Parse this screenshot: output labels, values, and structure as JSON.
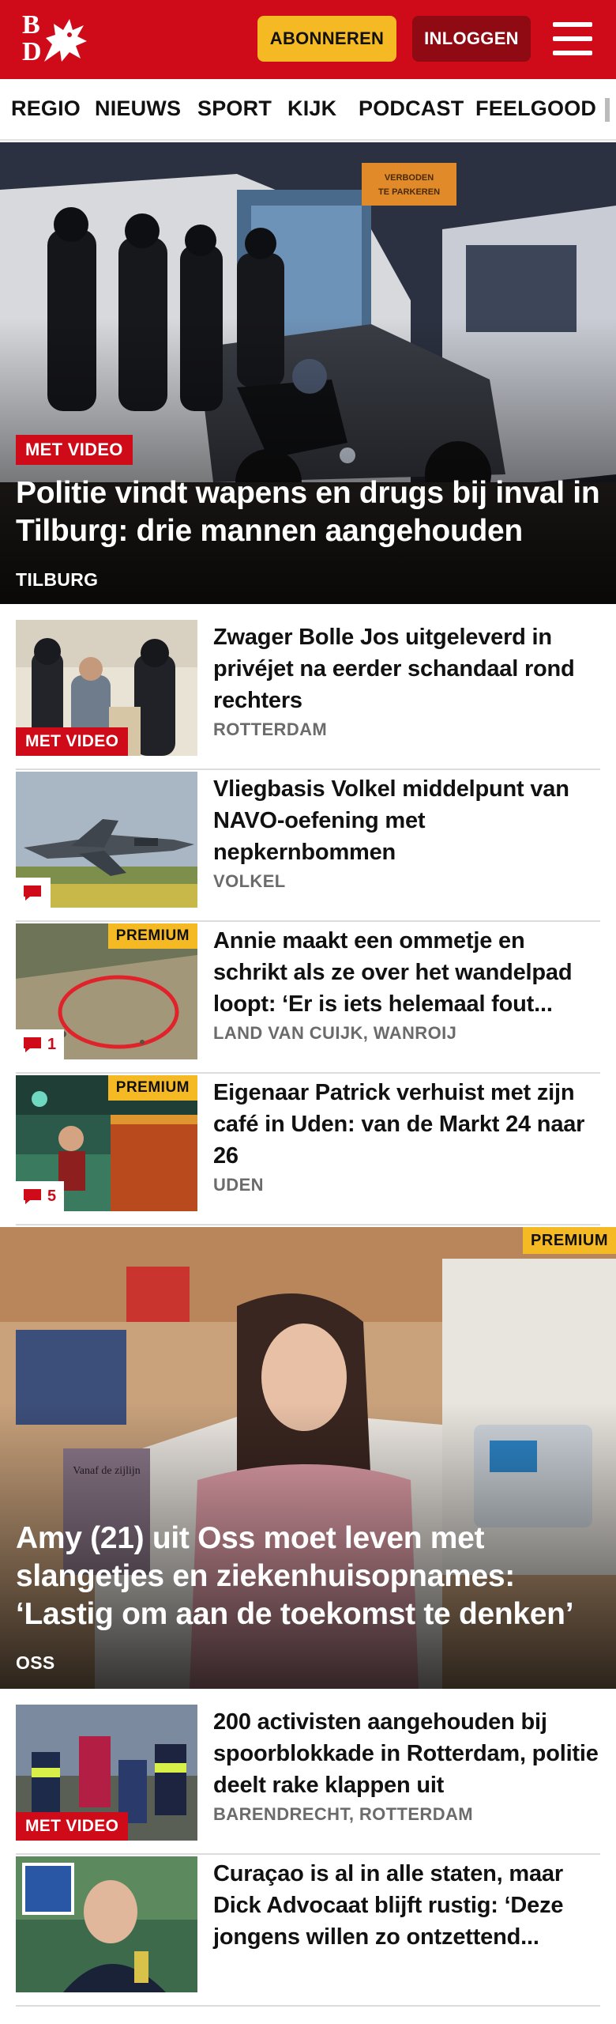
{
  "header": {
    "logo_text": "BD",
    "subscribe_label": "ABONNEREN",
    "login_label": "INLOGGEN",
    "brand_color": "#cf0b1a",
    "accent_color": "#f5b923"
  },
  "nav": {
    "items": [
      "REGIO",
      "NIEUWS",
      "SPORT",
      "KIJK",
      "PODCAST",
      "FEELGOOD"
    ]
  },
  "hero1": {
    "badge": "MET VIDEO",
    "title": "Politie vindt wapens en drugs bij inval in Tilburg: drie mannen aangehouden",
    "location": "TILBURG",
    "sign_text": "VERBODEN TE PARKEREN"
  },
  "articles1": [
    {
      "title": "Zwager Bolle Jos uitgeleverd in privéjet na eerder schandaal rond rechters",
      "location": "ROTTERDAM",
      "badge": "MET VIDEO"
    },
    {
      "title": "Vliegbasis Volkel middelpunt van NAVO-oefening met nepkernbommen",
      "location": "VOLKEL",
      "comment_icon": "comment-icon"
    },
    {
      "title": "Annie maakt een ommetje en schrikt als ze over het wandelpad loopt: ‘Er is iets helemaal fout...",
      "location": "LAND VAN CUIJK, WANROIJ",
      "badge": "PREMIUM",
      "comments": "1"
    },
    {
      "title": "Eigenaar Patrick verhuist met zijn café in Uden: van de Markt 24 naar 26",
      "location": "UDEN",
      "badge": "PREMIUM",
      "comments": "5"
    }
  ],
  "hero2": {
    "badge": "PREMIUM",
    "title": "Amy (21) uit Oss moet leven met slangetjes en ziekenhuisopnames: ‘Lastig om aan de toekomst te denken’",
    "location": "OSS",
    "book_text": "Vanaf de zijlijn"
  },
  "articles2": [
    {
      "title": "200 activisten aangehouden bij spoorblokkade in Rotterdam, politie deelt rake klappen uit",
      "location": "BARENDRECHT, ROTTERDAM",
      "badge": "MET VIDEO"
    },
    {
      "title": "Curaçao is al in alle staten, maar Dick Advocaat blijft rustig: ‘Deze jongens willen zo ontzettend...",
      "location": ""
    }
  ]
}
